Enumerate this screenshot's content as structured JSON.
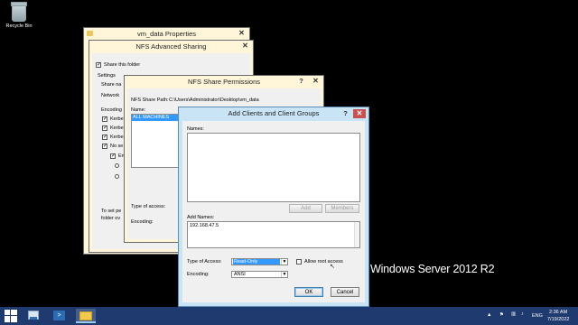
{
  "desktop": {
    "recycle_bin_label": "Recycle Bin",
    "brand_text": "Windows Server 2012 R2"
  },
  "properties_window": {
    "title": "vm_data Properties"
  },
  "nfs_sharing_window": {
    "title": "NFS Advanced Sharing",
    "share_this_folder_label": "Share this folder",
    "settings_label": "Settings",
    "share_name_label": "Share na",
    "network_label": "Network",
    "encoding_label": "Encoding",
    "kerberos_1": "Kerbe",
    "kerberos_2": "Kerbe",
    "kerberos_3": "Kerbe",
    "no_server_label": "No se",
    "enable_label": "En",
    "set_permissions_text_1": "To set pe",
    "set_permissions_text_2": "folder ov"
  },
  "permissions_window": {
    "title": "NFS Share Permissions",
    "share_path_label": "NFS Share Path:",
    "share_path_value": "C:\\Users\\Administrator\\Desktop\\vm_data",
    "name_label": "Name:",
    "names": [
      "ALL MACHINES"
    ],
    "type_of_access_label": "Type of access:",
    "encoding_label": "Encoding:"
  },
  "add_clients_dialog": {
    "title": "Add Clients and Client Groups",
    "names_label": "Names:",
    "add_button": "Add",
    "members_button": "Members",
    "add_names_label": "Add Names:",
    "add_names_value": "192.168.47.5",
    "type_of_access_label": "Type of Access:",
    "type_of_access_value": "Read-Only",
    "allow_root_access_label": "Allow root access",
    "encoding_label": "Encoding:",
    "encoding_value": "ANSI",
    "ok_button": "OK",
    "cancel_button": "Cancel"
  },
  "taskbar": {
    "language": "ENG",
    "time": "2:36 AM",
    "date": "7/19/2022"
  },
  "colors": {
    "desktop": "#000000",
    "taskbar": "#1f3a6e",
    "window_frame": "#fff6da",
    "dialog_frame": "#c9e4f5",
    "selection": "#3399ff"
  }
}
